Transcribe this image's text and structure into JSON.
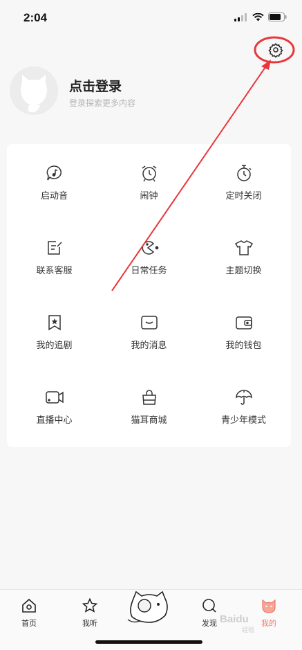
{
  "status_bar": {
    "time": "2:04"
  },
  "profile": {
    "title": "点击登录",
    "subtitle": "登录探索更多内容"
  },
  "grid": {
    "items": [
      {
        "label": "启动音",
        "icon": "music-bubble-icon"
      },
      {
        "label": "闹钟",
        "icon": "alarm-clock-icon"
      },
      {
        "label": "定时关闭",
        "icon": "timer-icon"
      },
      {
        "label": "联系客服",
        "icon": "edit-note-icon"
      },
      {
        "label": "日常任务",
        "icon": "pacman-icon"
      },
      {
        "label": "主题切换",
        "icon": "tshirt-icon"
      },
      {
        "label": "我的追剧",
        "icon": "bookmark-star-icon"
      },
      {
        "label": "我的消息",
        "icon": "message-box-icon"
      },
      {
        "label": "我的钱包",
        "icon": "wallet-icon"
      },
      {
        "label": "直播中心",
        "icon": "video-camera-icon"
      },
      {
        "label": "猫耳商城",
        "icon": "shopping-bag-icon"
      },
      {
        "label": "青少年模式",
        "icon": "umbrella-icon"
      }
    ]
  },
  "bottom_nav": {
    "items": [
      {
        "label": "首页",
        "icon": "home-icon"
      },
      {
        "label": "我听",
        "icon": "star-icon"
      },
      {
        "label": "发现",
        "icon": "discover-icon"
      },
      {
        "label": "我的",
        "icon": "cat-face-icon"
      }
    ]
  },
  "watermark": {
    "text": "Baidu",
    "sub": "经验"
  },
  "colors": {
    "accent": "#ef7a6a",
    "annotation": "#e8373c"
  }
}
